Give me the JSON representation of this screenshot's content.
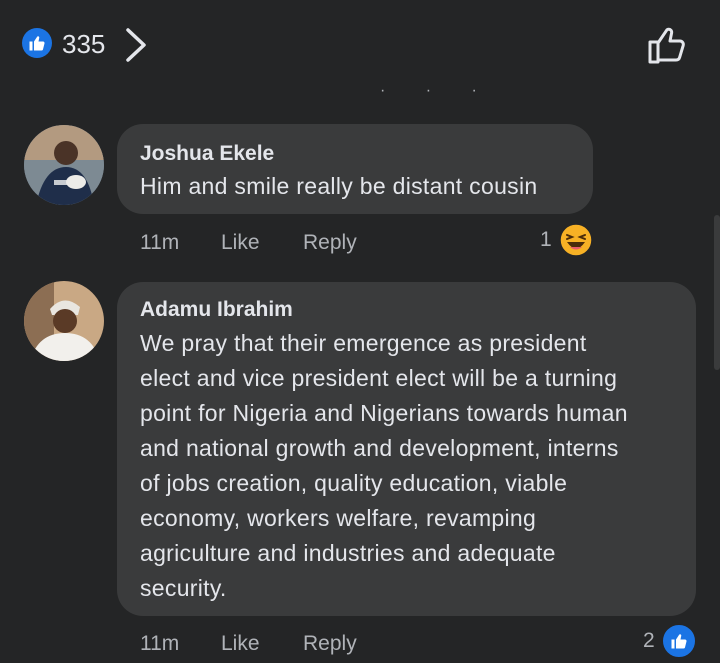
{
  "header": {
    "like_count": "335",
    "like_icon": "thumbs-up-icon",
    "accent": "#1b74e4"
  },
  "comments": [
    {
      "author": "Joshua Ekele",
      "text": "Him and smile really be distant cousin",
      "time": "11m",
      "like_label": "Like",
      "reply_label": "Reply",
      "reaction_count": "1",
      "reaction_icon": "haha-emoji-icon"
    },
    {
      "author": "Adamu Ibrahim",
      "text_lines": [
        "We pray that their emergence as president",
        "elect and vice president elect will be a turning",
        "point for Nigeria and Nigerians towards human",
        "and national growth and development, interns",
        "of jobs creation, quality education, viable",
        "economy, workers welfare, revamping",
        "agriculture and industries and adequate",
        "security."
      ],
      "time": "11m",
      "like_label": "Like",
      "reply_label": "Reply",
      "reaction_count": "2",
      "reaction_icon": "like-reaction-icon"
    }
  ]
}
